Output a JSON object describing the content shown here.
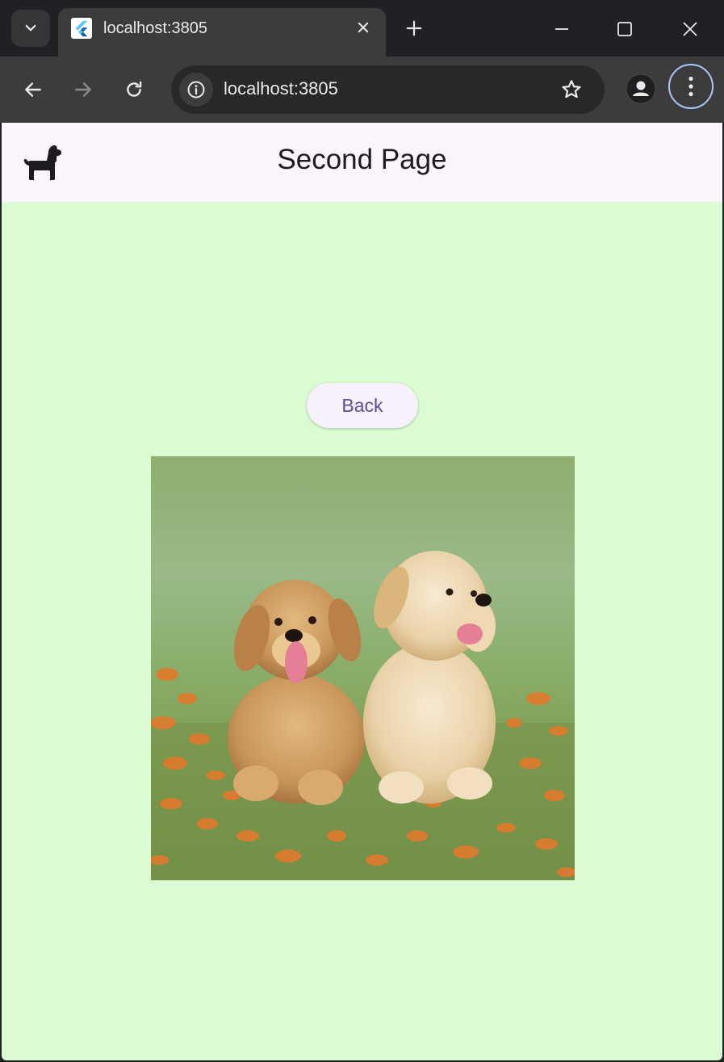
{
  "browser": {
    "tab": {
      "title": "localhost:3805",
      "favicon": "flutter-icon"
    },
    "address_bar": {
      "url": "localhost:3805"
    },
    "accent_color": "#a8c7fa"
  },
  "app": {
    "appbar": {
      "title": "Second Page",
      "leading_icon": "dog-icon",
      "background": "#fbf4fc"
    },
    "body_background": "#dbfcd2",
    "back_button": {
      "label": "Back",
      "text_color": "#5e4e9a"
    },
    "image": {
      "subject": "two-puppies-photo"
    }
  }
}
